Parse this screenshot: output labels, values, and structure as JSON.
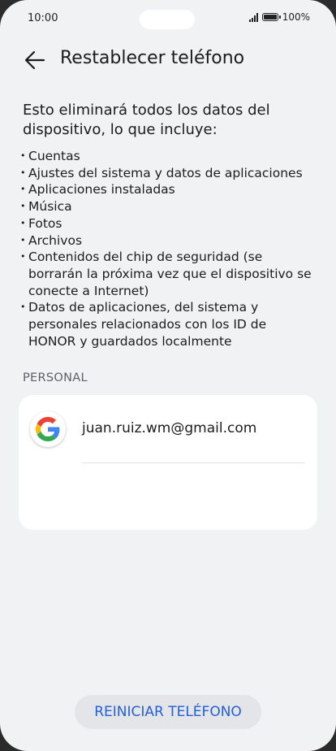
{
  "status_bar": {
    "time": "10:00",
    "battery": "100%"
  },
  "header": {
    "title": "Restablecer teléfono"
  },
  "content": {
    "intro": "Esto eliminará todos los datos del dispositivo, lo que incluye:",
    "items": [
      "Cuentas",
      "Ajustes del sistema y datos de aplicaciones",
      "Aplicaciones instaladas",
      "Música",
      "Fotos",
      "Archivos",
      "Contenidos del chip de seguridad (se borrarán la próxima vez que el dispositivo se conecte a Internet)",
      "Datos de aplicaciones, del sistema y personales relacionados con los ID de HONOR y guardados localmente"
    ]
  },
  "personal": {
    "section_label": "PERSONAL",
    "account": {
      "email": "juan.ruiz.wm@gmail.com",
      "icon": "google-icon"
    }
  },
  "footer": {
    "reset_label": "REINICIAR TELÉFONO"
  },
  "colors": {
    "accent": "#2560d4",
    "background": "#f1f2f4",
    "card": "#ffffff"
  }
}
